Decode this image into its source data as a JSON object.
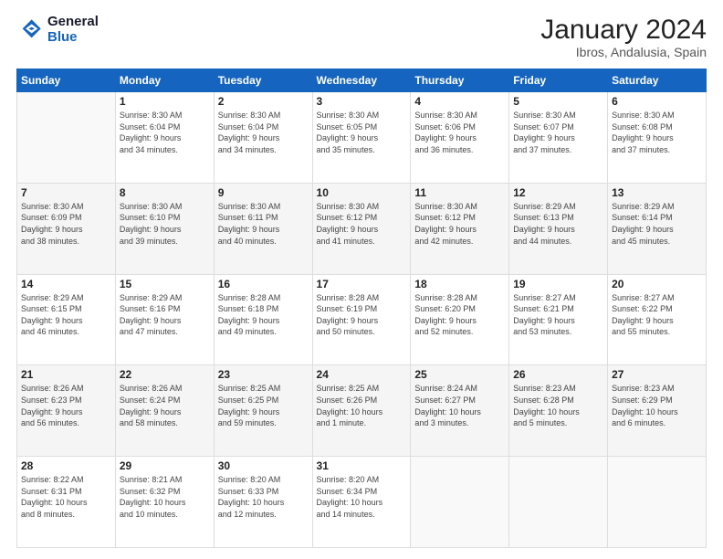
{
  "header": {
    "logo_line1": "General",
    "logo_line2": "Blue",
    "title": "January 2024",
    "subtitle": "Ibros, Andalusia, Spain"
  },
  "calendar": {
    "days_of_week": [
      "Sunday",
      "Monday",
      "Tuesday",
      "Wednesday",
      "Thursday",
      "Friday",
      "Saturday"
    ],
    "weeks": [
      [
        {
          "num": "",
          "info": ""
        },
        {
          "num": "1",
          "info": "Sunrise: 8:30 AM\nSunset: 6:04 PM\nDaylight: 9 hours\nand 34 minutes."
        },
        {
          "num": "2",
          "info": "Sunrise: 8:30 AM\nSunset: 6:04 PM\nDaylight: 9 hours\nand 34 minutes."
        },
        {
          "num": "3",
          "info": "Sunrise: 8:30 AM\nSunset: 6:05 PM\nDaylight: 9 hours\nand 35 minutes."
        },
        {
          "num": "4",
          "info": "Sunrise: 8:30 AM\nSunset: 6:06 PM\nDaylight: 9 hours\nand 36 minutes."
        },
        {
          "num": "5",
          "info": "Sunrise: 8:30 AM\nSunset: 6:07 PM\nDaylight: 9 hours\nand 37 minutes."
        },
        {
          "num": "6",
          "info": "Sunrise: 8:30 AM\nSunset: 6:08 PM\nDaylight: 9 hours\nand 37 minutes."
        }
      ],
      [
        {
          "num": "7",
          "info": "Sunrise: 8:30 AM\nSunset: 6:09 PM\nDaylight: 9 hours\nand 38 minutes."
        },
        {
          "num": "8",
          "info": "Sunrise: 8:30 AM\nSunset: 6:10 PM\nDaylight: 9 hours\nand 39 minutes."
        },
        {
          "num": "9",
          "info": "Sunrise: 8:30 AM\nSunset: 6:11 PM\nDaylight: 9 hours\nand 40 minutes."
        },
        {
          "num": "10",
          "info": "Sunrise: 8:30 AM\nSunset: 6:12 PM\nDaylight: 9 hours\nand 41 minutes."
        },
        {
          "num": "11",
          "info": "Sunrise: 8:30 AM\nSunset: 6:12 PM\nDaylight: 9 hours\nand 42 minutes."
        },
        {
          "num": "12",
          "info": "Sunrise: 8:29 AM\nSunset: 6:13 PM\nDaylight: 9 hours\nand 44 minutes."
        },
        {
          "num": "13",
          "info": "Sunrise: 8:29 AM\nSunset: 6:14 PM\nDaylight: 9 hours\nand 45 minutes."
        }
      ],
      [
        {
          "num": "14",
          "info": "Sunrise: 8:29 AM\nSunset: 6:15 PM\nDaylight: 9 hours\nand 46 minutes."
        },
        {
          "num": "15",
          "info": "Sunrise: 8:29 AM\nSunset: 6:16 PM\nDaylight: 9 hours\nand 47 minutes."
        },
        {
          "num": "16",
          "info": "Sunrise: 8:28 AM\nSunset: 6:18 PM\nDaylight: 9 hours\nand 49 minutes."
        },
        {
          "num": "17",
          "info": "Sunrise: 8:28 AM\nSunset: 6:19 PM\nDaylight: 9 hours\nand 50 minutes."
        },
        {
          "num": "18",
          "info": "Sunrise: 8:28 AM\nSunset: 6:20 PM\nDaylight: 9 hours\nand 52 minutes."
        },
        {
          "num": "19",
          "info": "Sunrise: 8:27 AM\nSunset: 6:21 PM\nDaylight: 9 hours\nand 53 minutes."
        },
        {
          "num": "20",
          "info": "Sunrise: 8:27 AM\nSunset: 6:22 PM\nDaylight: 9 hours\nand 55 minutes."
        }
      ],
      [
        {
          "num": "21",
          "info": "Sunrise: 8:26 AM\nSunset: 6:23 PM\nDaylight: 9 hours\nand 56 minutes."
        },
        {
          "num": "22",
          "info": "Sunrise: 8:26 AM\nSunset: 6:24 PM\nDaylight: 9 hours\nand 58 minutes."
        },
        {
          "num": "23",
          "info": "Sunrise: 8:25 AM\nSunset: 6:25 PM\nDaylight: 9 hours\nand 59 minutes."
        },
        {
          "num": "24",
          "info": "Sunrise: 8:25 AM\nSunset: 6:26 PM\nDaylight: 10 hours\nand 1 minute."
        },
        {
          "num": "25",
          "info": "Sunrise: 8:24 AM\nSunset: 6:27 PM\nDaylight: 10 hours\nand 3 minutes."
        },
        {
          "num": "26",
          "info": "Sunrise: 8:23 AM\nSunset: 6:28 PM\nDaylight: 10 hours\nand 5 minutes."
        },
        {
          "num": "27",
          "info": "Sunrise: 8:23 AM\nSunset: 6:29 PM\nDaylight: 10 hours\nand 6 minutes."
        }
      ],
      [
        {
          "num": "28",
          "info": "Sunrise: 8:22 AM\nSunset: 6:31 PM\nDaylight: 10 hours\nand 8 minutes."
        },
        {
          "num": "29",
          "info": "Sunrise: 8:21 AM\nSunset: 6:32 PM\nDaylight: 10 hours\nand 10 minutes."
        },
        {
          "num": "30",
          "info": "Sunrise: 8:20 AM\nSunset: 6:33 PM\nDaylight: 10 hours\nand 12 minutes."
        },
        {
          "num": "31",
          "info": "Sunrise: 8:20 AM\nSunset: 6:34 PM\nDaylight: 10 hours\nand 14 minutes."
        },
        {
          "num": "",
          "info": ""
        },
        {
          "num": "",
          "info": ""
        },
        {
          "num": "",
          "info": ""
        }
      ]
    ]
  }
}
